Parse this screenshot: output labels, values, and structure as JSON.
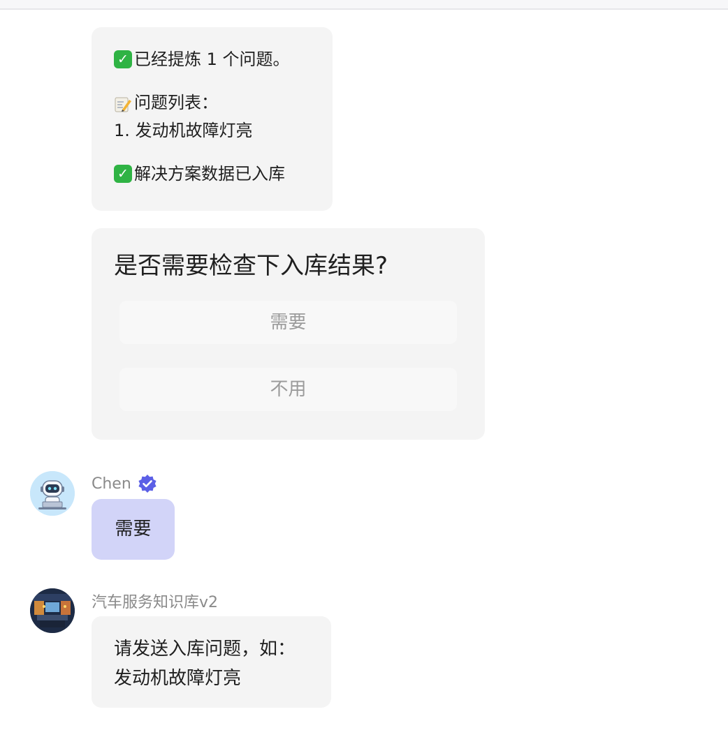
{
  "summary": {
    "extracted": "已经提炼 1 个问题。",
    "list_title": "问题列表：",
    "list_items": [
      "1. 发动机故障灯亮"
    ],
    "stored": "解决方案数据已入库"
  },
  "prompt": {
    "question": "是否需要检查下入库结果?",
    "options": [
      "需要",
      "不用"
    ]
  },
  "user_message": {
    "sender": "Chen",
    "text": "需要"
  },
  "bot_message": {
    "sender": "汽车服务知识库v2",
    "lines": [
      "请发送入库问题，如：",
      "发动机故障灯亮"
    ]
  },
  "colors": {
    "bubble": "#f4f4f4",
    "user_bubble": "#d2d4f8",
    "verified_badge": "#5b5fe6",
    "check_emoji": "#2fb344"
  },
  "icons": {
    "extracted_icon": "check-mark-button-emoji",
    "list_icon": "memo-emoji",
    "stored_icon": "check-mark-button-emoji",
    "verified_icon": "verified-badge-icon",
    "chen_avatar": "robot-avatar",
    "bot_avatar": "knowledge-base-avatar"
  }
}
